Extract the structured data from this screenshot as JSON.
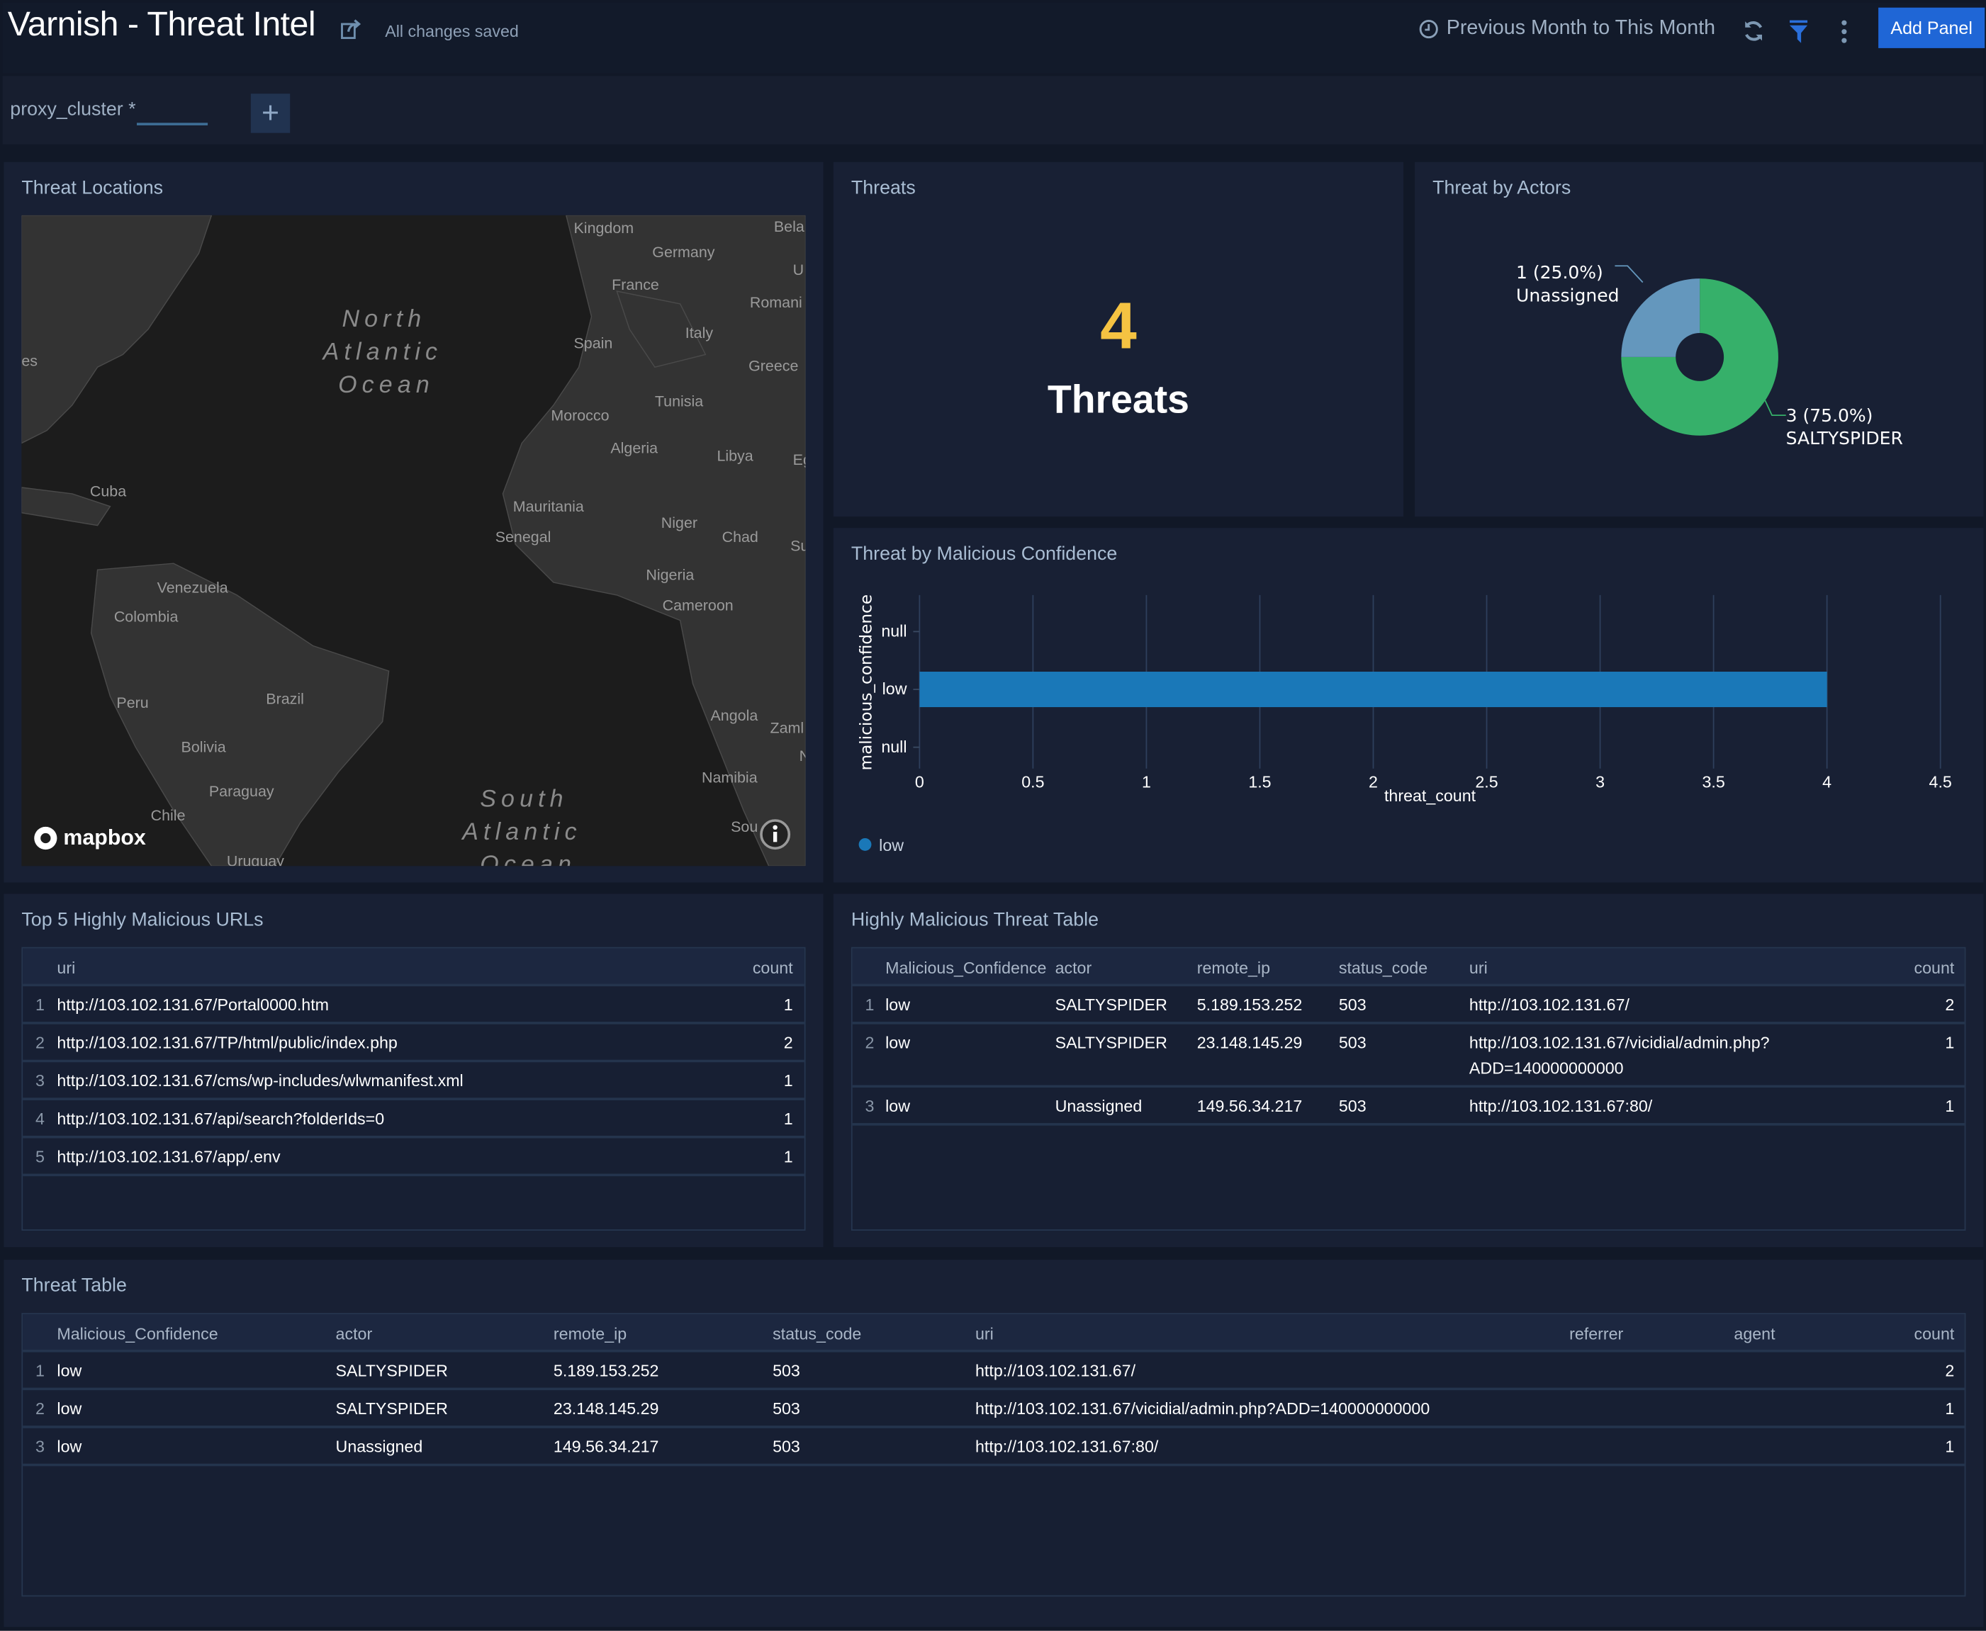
{
  "header": {
    "title": "Varnish - Threat Intel",
    "saved_status": "All changes saved",
    "time_range": "Previous Month to This Month",
    "add_panel_label": "Add Panel",
    "icons": [
      "share-icon",
      "clock-icon",
      "refresh-icon",
      "filter-icon",
      "more-vertical-icon"
    ],
    "accent": "#1f66d6"
  },
  "filters": {
    "proxy_cluster_label": "proxy_cluster",
    "proxy_cluster_value": "*"
  },
  "threat_locations": {
    "title": "Threat Locations",
    "map_attribution": "mapbox",
    "map_labels": [
      "Kingdom",
      "Germany",
      "Bela",
      "France",
      "U",
      "Romani",
      "Spain",
      "Italy",
      "Greece",
      "Morocco",
      "Tunisia",
      "Algeria",
      "Libya",
      "Eg",
      "Cuba",
      "Mauritania",
      "Niger",
      "Chad",
      "Senegal",
      "Su",
      "Nigeria",
      "Venezuela",
      "Cameroon",
      "Colombia",
      "Peru",
      "Brazil",
      "Angola",
      "Zaml",
      "Bolivia",
      "Namibia",
      "Paraguay",
      "Chile",
      "Sou",
      "Uruguay",
      "es",
      "N"
    ],
    "ocean_labels": [
      "North Atlantic Ocean",
      "South Atlantic Ocean"
    ]
  },
  "threats": {
    "title": "Threats",
    "value": "4",
    "label": "Threats",
    "value_color": "#f5c342"
  },
  "threat_by_actors": {
    "title": "Threat by Actors",
    "chart_data": {
      "type": "pie",
      "slices": [
        {
          "label": "SALTYSPIDER",
          "value": 3,
          "percent": "75.0%",
          "display": "3 (75.0%)",
          "color": "#36b06a"
        },
        {
          "label": "Unassigned",
          "value": 1,
          "percent": "25.0%",
          "display": "1 (25.0%)",
          "color": "#6497bd"
        }
      ]
    }
  },
  "malicious_confidence": {
    "title": "Threat by Malicious Confidence",
    "chart_data": {
      "type": "bar",
      "orientation": "horizontal",
      "categories": [
        "null",
        "low",
        "null"
      ],
      "values": [
        null,
        4,
        null
      ],
      "xlabel": "threat_count",
      "ylabel": "malicious_confidence",
      "xlim": [
        0,
        4.5
      ],
      "xticks": [
        "0",
        "0.5",
        "1",
        "1.5",
        "2",
        "2.5",
        "3",
        "3.5",
        "4",
        "4.5"
      ],
      "grid": true,
      "legend": "bottom-left",
      "series": [
        {
          "name": "low",
          "color": "#1a78b8"
        }
      ]
    }
  },
  "top_urls": {
    "title": "Top 5 Highly Malicious URLs",
    "columns": [
      "uri",
      "count"
    ],
    "rows": [
      [
        "1",
        "http://103.102.131.67/Portal0000.htm",
        "1"
      ],
      [
        "2",
        "http://103.102.131.67/TP/html/public/index.php",
        "2"
      ],
      [
        "3",
        "http://103.102.131.67/cms/wp-includes/wlwmanifest.xml",
        "1"
      ],
      [
        "4",
        "http://103.102.131.67/api/search?folderIds=0",
        "1"
      ],
      [
        "5",
        "http://103.102.131.67/app/.env",
        "1"
      ]
    ]
  },
  "highly_table": {
    "title": "Highly Malicious Threat Table",
    "columns": [
      "Malicious_Confidence",
      "actor",
      "remote_ip",
      "status_code",
      "uri",
      "count"
    ],
    "rows": [
      [
        "1",
        "low",
        "SALTYSPIDER",
        "5.189.153.252",
        "503",
        "http://103.102.131.67/",
        "2"
      ],
      [
        "2",
        "low",
        "SALTYSPIDER",
        "23.148.145.29",
        "503",
        "http://103.102.131.67/vicidial/admin.php?\nADD=140000000000",
        "1"
      ],
      [
        "3",
        "low",
        "Unassigned",
        "149.56.34.217",
        "503",
        "http://103.102.131.67:80/",
        "1"
      ]
    ]
  },
  "threat_table": {
    "title": "Threat Table",
    "columns": [
      "Malicious_Confidence",
      "actor",
      "remote_ip",
      "status_code",
      "uri",
      "referrer",
      "agent",
      "count"
    ],
    "rows": [
      [
        "1",
        "low",
        "SALTYSPIDER",
        "5.189.153.252",
        "503",
        "http://103.102.131.67/",
        "",
        "",
        "2"
      ],
      [
        "2",
        "low",
        "SALTYSPIDER",
        "23.148.145.29",
        "503",
        "http://103.102.131.67/vicidial/admin.php?ADD=140000000000",
        "",
        "",
        "1"
      ],
      [
        "3",
        "low",
        "Unassigned",
        "149.56.34.217",
        "503",
        "http://103.102.131.67:80/",
        "",
        "",
        "1"
      ]
    ]
  }
}
